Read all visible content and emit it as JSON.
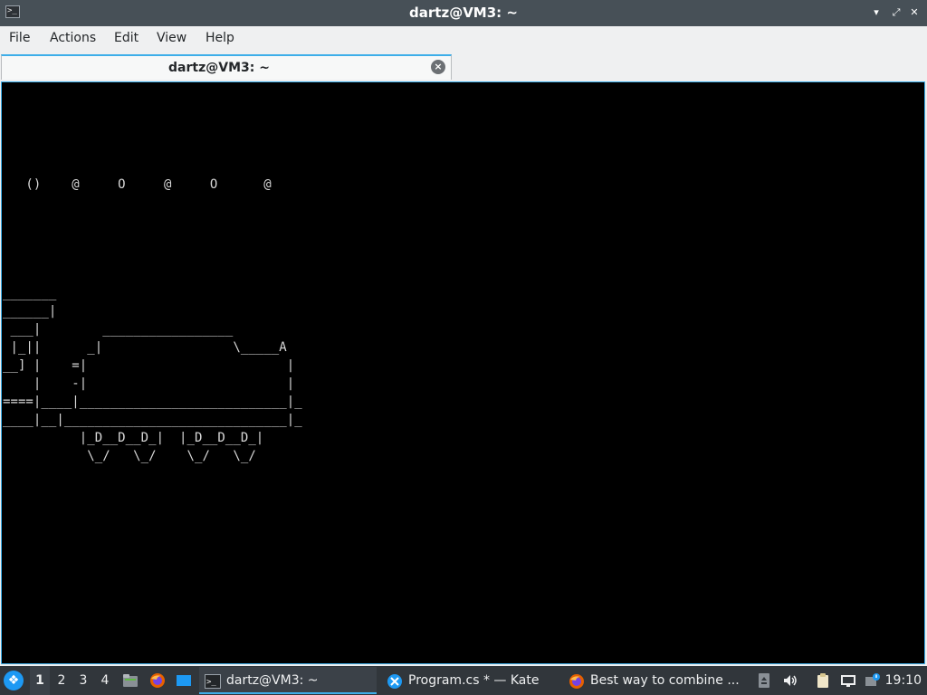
{
  "window": {
    "title": "dartz@VM3: ~",
    "controls": [
      "minimize-icon",
      "restore-icon",
      "close-icon"
    ]
  },
  "menubar": {
    "items": [
      "File",
      "Actions",
      "Edit",
      "View",
      "Help"
    ]
  },
  "tab": {
    "label": "dartz@VM3: ~",
    "close_icon": "close-circle-icon"
  },
  "terminal": {
    "lines": [
      "",
      "",
      "",
      "",
      "",
      "   ()    @     O     @     O      @",
      "",
      "",
      "",
      "",
      "",
      "_______",
      "______|",
      " ___|        _________________",
      " |_||      _|                 \\_____A",
      "__] |    =|                          |",
      "    |    -|                          |",
      "====|____|___________________________|_",
      "____|__|_____________________________|_",
      "          |_D__D__D_|  |_D__D__D_|",
      "           \\_/   \\_/    \\_/   \\_/"
    ]
  },
  "taskbar": {
    "start_icon": "application-launcher-icon",
    "desktops": [
      "1",
      "2",
      "3",
      "4"
    ],
    "active_desktop": "1",
    "quicklaunch": [
      "file-manager-icon",
      "firefox-icon",
      "show-desktop-icon"
    ],
    "tasks": [
      {
        "label": "dartz@VM3: ~",
        "icon": "terminal-icon",
        "active": true
      },
      {
        "label": "Program.cs * — Kate",
        "icon": "kate-icon",
        "active": false
      },
      {
        "label": "Best way to combine ...",
        "icon": "firefox-icon",
        "active": false
      }
    ],
    "tray": [
      "removable-media-icon",
      "volume-icon",
      "clipboard-icon",
      "network-icon",
      "updates-icon"
    ],
    "clock": "19:10"
  },
  "colors": {
    "titlebar": "#475057",
    "accent": "#3daee9",
    "terminal_bg": "#000000",
    "terminal_fg": "#d8d8d8",
    "taskbar": "#31363b"
  }
}
